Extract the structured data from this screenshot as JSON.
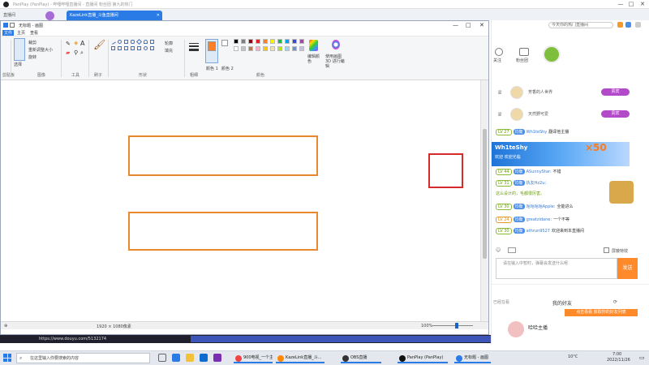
{
  "browser": {
    "title": "PanPlay (PanPlay) - 哔哩哔哩直播间 - 直播间 粉丝团 第九的热门",
    "tabs": [
      {
        "label": "直播间"
      },
      {
        "label": "KazeLink直播_斗鱼直播间"
      }
    ],
    "controls": {
      "minimize": "—",
      "maximize": "□",
      "close": "✕"
    }
  },
  "paint": {
    "title": "无标题 - 画图",
    "menu": [
      "文件",
      "主页",
      "查看"
    ],
    "ribbon": {
      "groups": [
        {
          "label": "剪贴板"
        },
        {
          "label": "图像"
        },
        {
          "label": "工具"
        },
        {
          "label": "刷子"
        },
        {
          "label": "形状"
        },
        {
          "label": "粗细"
        },
        {
          "label": "颜色 1"
        },
        {
          "label": "颜色 2"
        },
        {
          "label": "颜色"
        },
        {
          "label": "编辑颜色"
        },
        {
          "label": "使用画图 3D 进行编辑"
        }
      ],
      "image_items": [
        "选择",
        "裁剪",
        "重新调整大小",
        "旋转"
      ],
      "shape_opts": [
        "轮廓",
        "填充"
      ],
      "palette": [
        "#000000",
        "#7f7f7f",
        "#880015",
        "#ed1c24",
        "#ff7f27",
        "#fff200",
        "#22b14c",
        "#00a2e8",
        "#3f48cc",
        "#a349a4",
        "#ffffff",
        "#c3c3c3",
        "#b97a57",
        "#ffaec9",
        "#ffc90e",
        "#efe4b0",
        "#b5e61d",
        "#99d9ea",
        "#7092be",
        "#c8bfe7"
      ],
      "color1": "#ff7f27",
      "color2": "#ffffff"
    },
    "status": {
      "size": "1920 × 1080像素",
      "zoom": "100%"
    }
  },
  "canvas": {
    "shapes": [
      {
        "kind": "rect",
        "color": "#e8892e"
      },
      {
        "kind": "rect",
        "color": "#e8892e"
      },
      {
        "kind": "rect",
        "color": "#d62b2b"
      }
    ]
  },
  "below_strip": {
    "url": "https://www.douyu.com/5132174"
  },
  "live": {
    "addr_search": "今天你的热门直播间",
    "top_icons": [
      {
        "label": "关注"
      },
      {
        "label": "粉丝团"
      }
    ],
    "rank_rows": [
      {
        "name": "芳香的人世界",
        "btn": "贵宾"
      },
      {
        "name": "天然野可爱",
        "btn": "贵宾"
      }
    ],
    "chat": [
      {
        "lv": "LV 27",
        "tag": "均衡",
        "user": "Wh1teShy",
        "text": "翻译他主播"
      },
      {
        "lv": "LV 44",
        "tag": "均衡",
        "user": "ASunnyStar:",
        "text": "不错"
      },
      {
        "lv": "LV 31",
        "tag": "均衡",
        "user": "执友Hz2u：",
        "text": ""
      },
      {
        "lv": "",
        "tag": "",
        "user": "",
        "text": "这么设计的，毛都很厉害。"
      },
      {
        "lv": "LV 30",
        "tag": "均衡",
        "user": "咕咕咕咕Apple:",
        "text": "全能进么"
      },
      {
        "lv": "LV 24",
        "tag": "均衡",
        "user": "greatzidane:",
        "text": "一个不等"
      },
      {
        "lv": "LV 30",
        "tag": "均衡",
        "user": "athrun9527",
        "text": "欢迎来到本直播间"
      }
    ],
    "banner": {
      "name": "Wh1teShy",
      "sub": "欢迎 欢迎光临",
      "count": "×50"
    },
    "input_placeholder": "请在输入中暂时，弹幕会发送什么呢",
    "send_label": "发送",
    "checkbox_label": "屏蔽特效",
    "friends_title": "我的好友",
    "friends_left": "已经在看",
    "friends_btn": "点击看看 获取你的好友列表",
    "friend_name": "哈哈主播"
  },
  "taskbar": {
    "search_placeholder": "在这里输入你要搜索的内容",
    "apps": [
      {
        "label": "900电视_一个主持...",
        "color": "#e44"
      },
      {
        "label": "KazeLink直播_斗...",
        "color": "#f80"
      },
      {
        "label": "OBS直播",
        "color": "#333"
      },
      {
        "label": "PanPlay (PanPlay)",
        "color": "#111"
      },
      {
        "label": "无标题 - 画图",
        "color": "#2a7be6"
      }
    ],
    "time": "7:00",
    "date": "2022/11/26",
    "tray": "10°C"
  }
}
